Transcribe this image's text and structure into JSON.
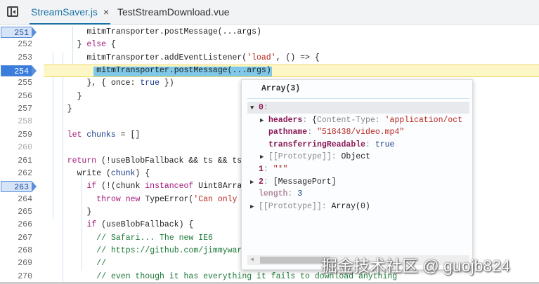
{
  "tabs": [
    {
      "label": "StreamSaver.js",
      "active": true,
      "close": "×"
    },
    {
      "label": "TestStreamDownload.vue",
      "active": false
    }
  ],
  "lines": [
    {
      "n": "251",
      "bp": true,
      "ind": 8,
      "t": [
        [
          "",
          "mitmTransporter.postMessage(...args)"
        ]
      ]
    },
    {
      "n": "252",
      "ind": 6,
      "t": [
        [
          "",
          "} "
        ],
        [
          "kw",
          "else"
        ],
        [
          "",
          " {"
        ]
      ]
    },
    {
      "n": "253",
      "ind": 8,
      "t": [
        [
          "",
          "mitmTransporter.addEventListener("
        ],
        [
          "str",
          "'load'"
        ],
        [
          "",
          ", () => {"
        ]
      ]
    },
    {
      "n": "254",
      "bp": true,
      "current": true,
      "ind": 10,
      "t": [
        [
          "",
          "mitmTransporter.postMessage(...args)"
        ]
      ]
    },
    {
      "n": "255",
      "ind": 8,
      "t": [
        [
          "",
          "}, { once: "
        ],
        [
          "bl",
          "true"
        ],
        [
          "",
          " })"
        ]
      ]
    },
    {
      "n": "256",
      "ind": 6,
      "t": [
        [
          "",
          "}"
        ]
      ]
    },
    {
      "n": "257",
      "ind": 4,
      "t": [
        [
          "",
          "}"
        ]
      ]
    },
    {
      "n": "258",
      "dim": true,
      "ind": 0,
      "t": []
    },
    {
      "n": "259",
      "ind": 4,
      "t": [
        [
          "kw",
          "let"
        ],
        [
          "",
          " "
        ],
        [
          "id",
          "chunks"
        ],
        [
          "",
          " = []"
        ]
      ]
    },
    {
      "n": "260",
      "dim": true,
      "ind": 0,
      "t": []
    },
    {
      "n": "261",
      "ind": 4,
      "t": [
        [
          "kw",
          "return"
        ],
        [
          "",
          " (!useBlobFallback && ts && ts"
        ]
      ]
    },
    {
      "n": "262",
      "ind": 6,
      "t": [
        [
          "",
          "write ("
        ],
        [
          "id",
          "chunk"
        ],
        [
          "",
          ") {"
        ]
      ]
    },
    {
      "n": "263",
      "bp": true,
      "ind": 8,
      "t": [
        [
          "kw",
          "if"
        ],
        [
          "",
          " (!(chunk "
        ],
        [
          "kw",
          "instanceof"
        ],
        [
          "",
          " Uint8Arra"
        ]
      ]
    },
    {
      "n": "264",
      "ind": 10,
      "t": [
        [
          "kw",
          "throw new"
        ],
        [
          "",
          " TypeError("
        ],
        [
          "str",
          "'Can only"
        ]
      ]
    },
    {
      "n": "265",
      "ind": 8,
      "t": [
        [
          "",
          "}"
        ]
      ]
    },
    {
      "n": "266",
      "ind": 8,
      "t": [
        [
          "kw",
          "if"
        ],
        [
          "",
          " (useBlobFallback) {"
        ]
      ]
    },
    {
      "n": "267",
      "ind": 10,
      "t": [
        [
          "cm",
          "// Safari... The new IE6"
        ]
      ]
    },
    {
      "n": "268",
      "ind": 10,
      "t": [
        [
          "cm",
          "// https://github.com/jimmywar"
        ]
      ]
    },
    {
      "n": "269",
      "ind": 10,
      "t": [
        [
          "cm",
          "//"
        ]
      ]
    },
    {
      "n": "270",
      "ind": 10,
      "t": [
        [
          "cm",
          "// even though it has everything it fails to download anything"
        ]
      ]
    }
  ],
  "popup": {
    "title": "Array(3)",
    "rows": [
      {
        "ind": 0,
        "tri": "▼",
        "sel": true,
        "t": [
          [
            "k",
            "0"
          ],
          [
            "g",
            ":"
          ]
        ]
      },
      {
        "ind": 1,
        "tri": "▶",
        "t": [
          [
            "k",
            "headers"
          ],
          [
            "g",
            ": "
          ],
          [
            "",
            "{"
          ],
          [
            "g",
            "Content-Type: "
          ],
          [
            "s",
            "'application/oct"
          ]
        ]
      },
      {
        "ind": 1,
        "tri": "",
        "t": [
          [
            "k",
            "pathname"
          ],
          [
            "g",
            ": "
          ],
          [
            "s",
            "\"518438/video.mp4\""
          ]
        ]
      },
      {
        "ind": 1,
        "tri": "",
        "t": [
          [
            "k",
            "transferringReadable"
          ],
          [
            "g",
            ": "
          ],
          [
            "n",
            "true"
          ]
        ]
      },
      {
        "ind": 1,
        "tri": "▶",
        "t": [
          [
            "g",
            "[[Prototype]]: "
          ],
          [
            "",
            "Object"
          ]
        ]
      },
      {
        "ind": 0,
        "tri": "",
        "t": [
          [
            "k",
            "1"
          ],
          [
            "g",
            ": "
          ],
          [
            "s",
            "\"*\""
          ]
        ]
      },
      {
        "ind": 0,
        "tri": "▶",
        "t": [
          [
            "k",
            "2"
          ],
          [
            "g",
            ": "
          ],
          [
            "",
            "[MessagePort]"
          ]
        ]
      },
      {
        "ind": 0,
        "tri": "",
        "t": [
          [
            "kd",
            "length"
          ],
          [
            "g",
            ": "
          ],
          [
            "n",
            "3"
          ]
        ]
      },
      {
        "ind": 0,
        "tri": "▶",
        "t": [
          [
            "g",
            "[[Prototype]]: "
          ],
          [
            "",
            "Array(0)"
          ]
        ]
      }
    ]
  },
  "watermark": "掘金技术社区 @ guojb824"
}
